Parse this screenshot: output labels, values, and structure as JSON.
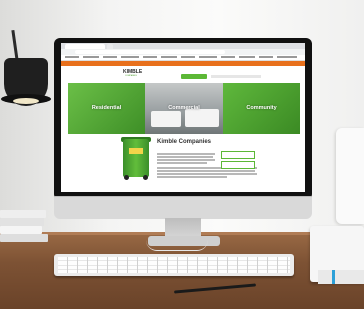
{
  "website": {
    "top_bar": {
      "text": ""
    },
    "logo": {
      "name": "KIMBLE",
      "tagline": "COMPANIES"
    },
    "nav_button": "",
    "hero_panels": [
      {
        "label": "Residential"
      },
      {
        "label": "Commercial"
      },
      {
        "label": "Community"
      }
    ],
    "intro": {
      "title": "Kimble Companies",
      "subtitle": "",
      "cta_buttons": [
        "",
        ""
      ]
    }
  },
  "colors": {
    "brand_green": "#5cb836",
    "top_bar_orange": "#e8701c"
  },
  "icons": [
    "lamp-icon",
    "trash-can-icon",
    "monitor-icon",
    "keyboard-icon"
  ]
}
